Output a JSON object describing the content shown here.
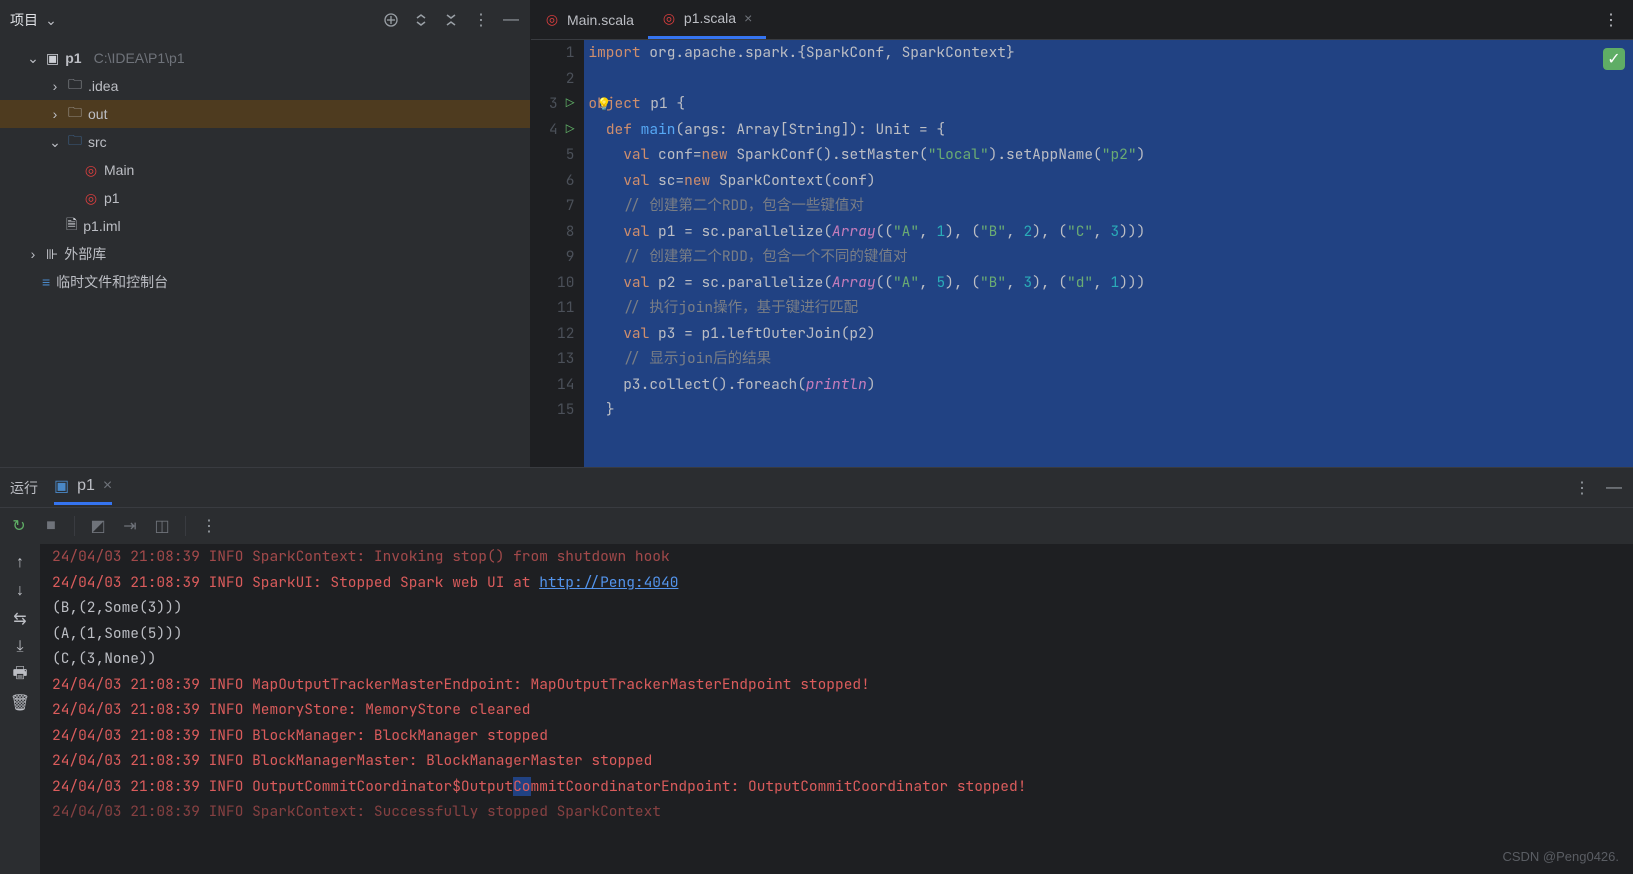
{
  "project_panel": {
    "title": "项目",
    "root": {
      "name": "p1",
      "path": "C:\\IDEA\\P1\\p1"
    },
    "nodes": {
      "idea": ".idea",
      "out": "out",
      "src": "src",
      "main": "Main",
      "p1": "p1",
      "iml": "p1.iml",
      "ext": "外部库",
      "scratch": "临时文件和控制台"
    }
  },
  "tabs": {
    "main": "Main.scala",
    "p1": "p1.scala"
  },
  "code": {
    "l1_import": "import",
    "l1_pkg": " org.apache.spark.{SparkConf, SparkContext}",
    "l3_obj": "object",
    "l3_name": " p1 {",
    "l4_def": "def",
    "l4_main": " main",
    "l4_sig": "(args: Array[String]): Unit = {",
    "l5_val": "val",
    "l5_a": " conf=",
    "l5_new": "new",
    "l5_b": " SparkConf().setMaster(",
    "l5_str": "\"local\"",
    "l5_c": ").setAppName(",
    "l5_str2": "\"p2\"",
    "l5_d": ")",
    "l6_val": "val",
    "l6_a": " sc=",
    "l6_new": "new",
    "l6_b": " SparkContext(conf)",
    "l7_cmt": "// 创建第二个RDD，包含一些键值对",
    "l8_val": "val",
    "l8_a": " p1 = sc.parallelize(",
    "l8_arr": "Array",
    "l8_b": "((",
    "l8_s1": "\"A\"",
    "l8_c": ", ",
    "l8_n1": "1",
    "l8_d": "), (",
    "l8_s2": "\"B\"",
    "l8_e": ", ",
    "l8_n2": "2",
    "l8_f": "), (",
    "l8_s3": "\"C\"",
    "l8_g": ", ",
    "l8_n3": "3",
    "l8_h": ")))",
    "l9_cmt": "// 创建第二个RDD，包含一个不同的键值对",
    "l10_val": "val",
    "l10_a": " p2 = sc.parallelize(",
    "l10_arr": "Array",
    "l10_b": "((",
    "l10_s1": "\"A\"",
    "l10_c": ", ",
    "l10_n1": "5",
    "l10_d": "), (",
    "l10_s2": "\"B\"",
    "l10_e": ", ",
    "l10_n2": "3",
    "l10_f": "), (",
    "l10_s3": "\"d\"",
    "l10_g": ", ",
    "l10_n3": "1",
    "l10_h": ")))",
    "l11_cmt": "// 执行join操作，基于键进行匹配",
    "l12_val": "val",
    "l12_a": " p3 = p1.leftOuterJoin(p2)",
    "l13_cmt": "// 显示join后的结果",
    "l14_a": "p3.collect().foreach(",
    "l14_fn": "println",
    "l14_b": ")",
    "l15": "}"
  },
  "gutter_lines": [
    "1",
    "2",
    "3",
    "4",
    "5",
    "6",
    "7",
    "8",
    "9",
    "10",
    "11",
    "12",
    "13",
    "14",
    "15"
  ],
  "run_panel": {
    "title": "运行",
    "tab": "p1"
  },
  "console": {
    "l0_a": "24/04/03 21:08:39 INFO SparkContext: Invoking stop() from shutdown hook",
    "l1_a": "24/04/03 21:08:39 INFO SparkUI: Stopped Spark web UI at ",
    "l1_link": "http://Peng:4040",
    "l2": "(B,(2,Some(3)))",
    "l3": "(A,(1,Some(5)))",
    "l4": "(C,(3,None))",
    "l5": "24/04/03 21:08:39 INFO MapOutputTrackerMasterEndpoint: MapOutputTrackerMasterEndpoint stopped!",
    "l6": "24/04/03 21:08:39 INFO MemoryStore: MemoryStore cleared",
    "l7": "24/04/03 21:08:39 INFO BlockManager: BlockManager stopped",
    "l8": "24/04/03 21:08:39 INFO BlockManagerMaster: BlockManagerMaster stopped",
    "l9_a": "24/04/03 21:08:39 INFO OutputCommitCoordinator$Output",
    "l9_hl": "Co",
    "l9_b": "mmitCoordinatorEndpoint: OutputCommitCoordinator stopped!",
    "l10": "24/04/03 21:08:39 INFO SparkContext: Successfully stopped SparkContext"
  },
  "watermark": "CSDN @Peng0426."
}
